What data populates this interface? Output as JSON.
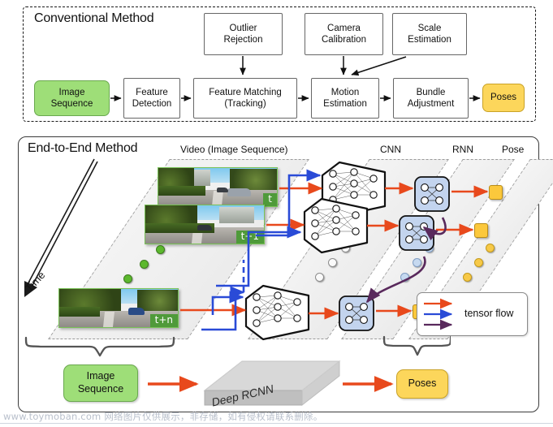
{
  "conventional": {
    "title": "Conventional Method",
    "nodes": [
      {
        "id": "image-sequence",
        "label": "Image\nSequence",
        "style": "green"
      },
      {
        "id": "feature-detection",
        "label": "Feature\nDetection",
        "style": "plain"
      },
      {
        "id": "feature-matching",
        "label": "Feature Matching\n(Tracking)",
        "style": "plain"
      },
      {
        "id": "motion-estimation",
        "label": "Motion\nEstimation",
        "style": "plain"
      },
      {
        "id": "bundle-adjustment",
        "label": "Bundle\nAdjustment",
        "style": "plain"
      },
      {
        "id": "poses",
        "label": "Poses",
        "style": "yellow"
      }
    ],
    "top_nodes": [
      {
        "id": "outlier-rejection",
        "label": "Outlier\nRejection"
      },
      {
        "id": "camera-calibration",
        "label": "Camera\nCalibration"
      },
      {
        "id": "scale-estimation",
        "label": "Scale\nEstimation"
      }
    ]
  },
  "end_to_end": {
    "title": "End-to-End Method",
    "column_labels": {
      "video": "Video (Image Sequence)",
      "cnn": "CNN",
      "rnn": "RNN",
      "pose": "Pose"
    },
    "time_axis_label": "Time",
    "frames": [
      {
        "id": "frame-t",
        "label": "t"
      },
      {
        "id": "frame-t1",
        "label": "t+1"
      },
      {
        "id": "frame-tn",
        "label": "t+n"
      }
    ],
    "legend": {
      "text": "tensor flow",
      "arrows": [
        {
          "name": "tensor-flow-arrow-orange",
          "color": "#e8491c"
        },
        {
          "name": "tensor-flow-arrow-blue",
          "color": "#2a4bd7"
        },
        {
          "name": "tensor-flow-arrow-purple",
          "color": "#59295c"
        }
      ]
    },
    "summary_flow": {
      "input": "Image\nSequence",
      "model": "Deep RCNN",
      "output": "Poses"
    }
  },
  "colors": {
    "green_fill": "#9ede78",
    "yellow_fill": "#fcd65b",
    "orange_arrow": "#e8491c",
    "blue_arrow": "#2a4bd7",
    "purple_arrow": "#59295c",
    "rnn_fill": "#c3d4ee",
    "plane_fill": "#efefef"
  },
  "watermark": {
    "text": "www.toymoban.com 网络图片仅供展示，非存储，如有侵权请联系删除。"
  }
}
